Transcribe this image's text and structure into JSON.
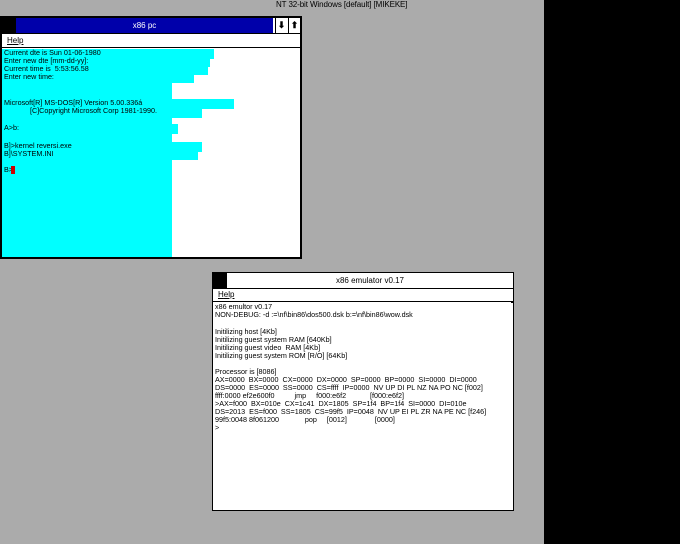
{
  "desktop": {
    "title": "NT 32-bit Windows [default] [MIKEKE]",
    "background": "#ababab"
  },
  "pc_window": {
    "title": "x86 pc",
    "titlebar_color": "#0000aa",
    "screen_color": "#00ffff",
    "menu": [
      "Help"
    ],
    "lines": [
      "Current dte is Sun 01-06-1980",
      "Enter new dte [mm-dd-yy]:",
      "Current time is  5:53:56.58",
      "Enter new time:",
      "",
      "",
      "Microsoft[R] MS-DOS[R] Version 5.00.336á",
      "             [C]Copyright Microsoft Corp 1981-1990.",
      "",
      "A>b:",
      "",
      "B]>kernel reversi.exe",
      "B]\\SYSTEM.INI",
      "",
      "B>"
    ]
  },
  "emu_window": {
    "title": "x86 emulator v0.17",
    "menu": [
      "Help"
    ],
    "lines": [
      "x86 emultor v0.17",
      "NON-DEBUG: -d :=\\nf\\bin86\\dos500.dsk b:=\\nf\\bin86\\wow.dsk",
      "",
      "Initilizing host [4Kb]",
      "Initilizing guest system RAM [640Kb]",
      "Initilizing guest video  RAM [4Kb]",
      "Initilizing guest system ROM [R/O] [64Kb]",
      "",
      "Processor is [8086]",
      "AX=0000  BX=0000  CX=0000  DX=0000  SP=0000  BP=0000  SI=0000  DI=0000",
      "DS=0000  ES=0000  SS=0000  CS=ffff  IP=0000  NV UP DI PL NZ NA PO NC [f002]",
      "ffff:0000 ef2e600f0          jmp     f000:e6f2            [f000:e6f2]",
      ">AX=f000  BX=010e  CX=1c41  DX=1805  SP=1f4  BP=1f4  SI=0000  DI=010e",
      "DS=2013  ES=f000  SS=1805  CS=99f5  IP=0048  NV UP EI PL ZR NA PE NC [f246]",
      "99f5:0048 8f061200             pop     [0012]              [0000]",
      ">"
    ]
  }
}
